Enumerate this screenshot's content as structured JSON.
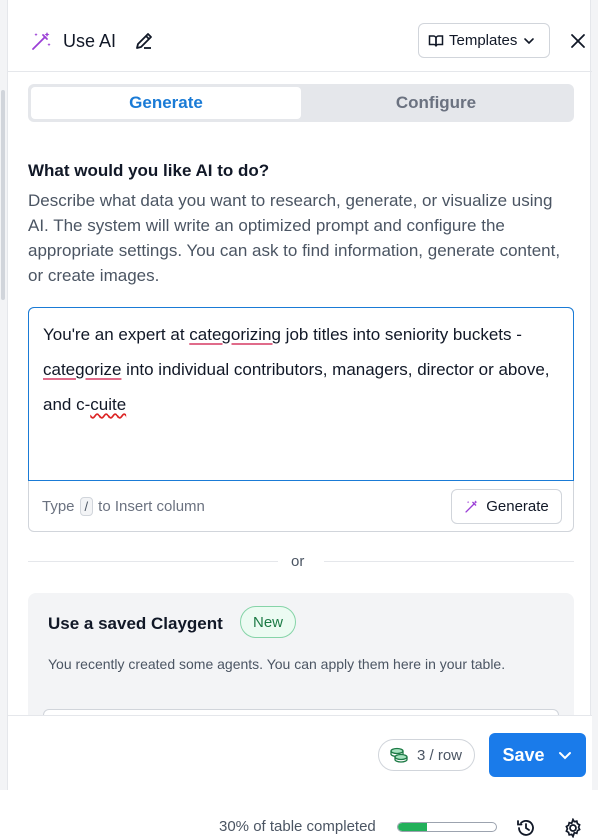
{
  "header": {
    "title": "Use AI",
    "templates_label": "Templates"
  },
  "tabs": {
    "generate": "Generate",
    "configure": "Configure"
  },
  "prompt_section": {
    "title": "What would you like AI to do?",
    "description": "Describe what data you want to research, generate, or visualize using AI. The system will write an optimized prompt and configure the appropriate settings. You can ask to find information, generate content, or create images.",
    "text_parts": [
      "You're an expert at ",
      "categorizing",
      " job titles into seniority buckets - ",
      "categorize",
      " into individual contributors, managers, director or above, and c-",
      "cuite"
    ],
    "hint_prefix": "Type",
    "hint_key": "/",
    "hint_suffix": "to Insert column",
    "generate_label": "Generate"
  },
  "or_label": "or",
  "saved": {
    "title": "Use a saved Claygent",
    "badge": "New",
    "description": "You recently created some agents. You can apply them here in your table."
  },
  "footer": {
    "cost": "3 / row",
    "save_label": "Save"
  },
  "status": {
    "progress_text": "30% of table completed",
    "progress_fraction": 0.3
  },
  "colors": {
    "accent": "#1a7bea",
    "active_tab": "#1a7bd6",
    "progress": "#22b05a"
  }
}
